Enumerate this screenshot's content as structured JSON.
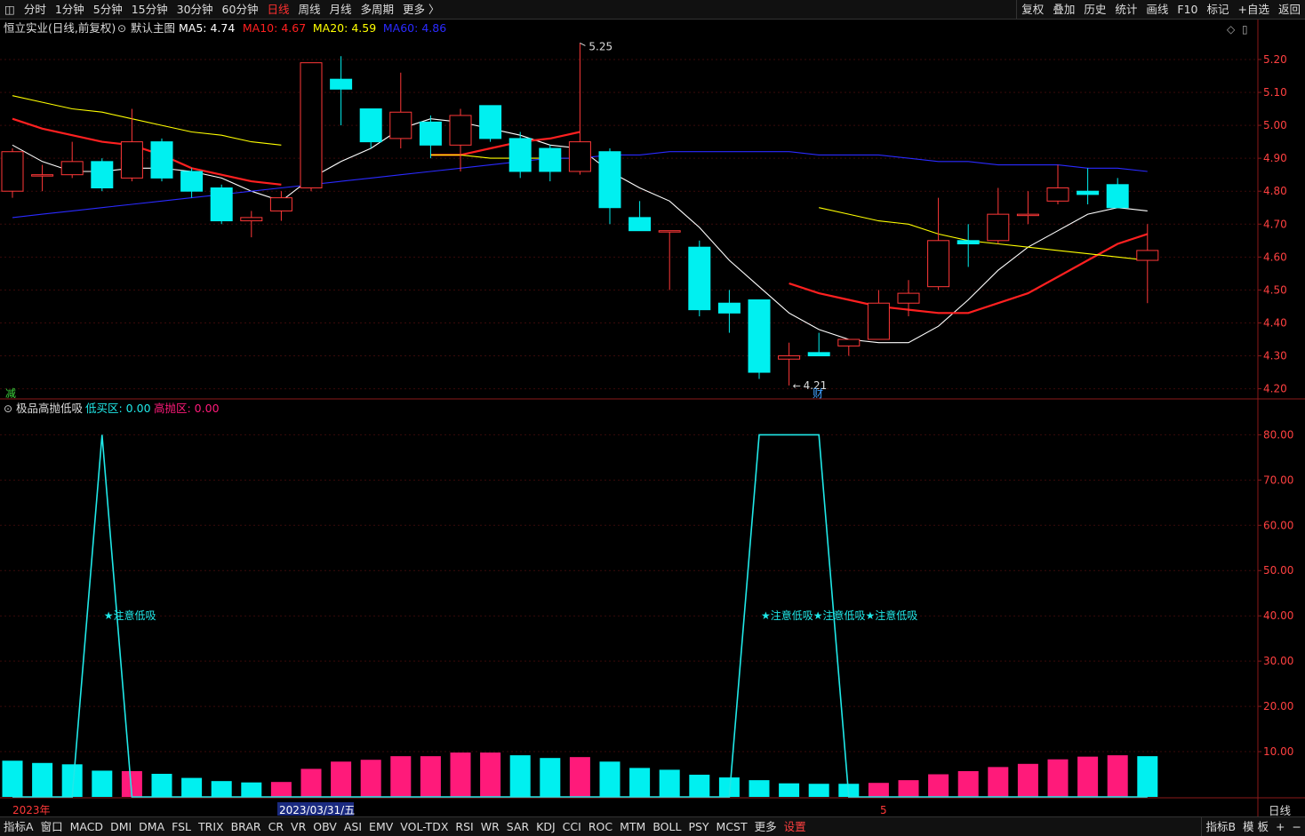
{
  "toolbar": {
    "periods": [
      "分时",
      "1分钟",
      "5分钟",
      "15分钟",
      "30分钟",
      "60分钟",
      "日线",
      "周线",
      "月线",
      "多周期",
      "更多 〉"
    ],
    "active_period": "日线",
    "right_items": [
      "复权",
      "叠加",
      "历史",
      "统计",
      "画线",
      "F10",
      "标记",
      "+自选",
      "返回"
    ]
  },
  "main_header": {
    "stock": "恒立实业(日线,前复权)",
    "template": "默认主图",
    "ma_labels": [
      {
        "text": "MA5: 4.74",
        "color": "#ffffff"
      },
      {
        "text": "MA10: 4.67",
        "color": "#ff2020"
      },
      {
        "text": "MA20: 4.59",
        "color": "#ffff00"
      },
      {
        "text": "MA60: 4.86",
        "color": "#2a2aff"
      }
    ]
  },
  "indicator_header": {
    "name": "极品高抛低吸",
    "low_label": "低买区: 0.00",
    "high_label": "高抛区: 0.00"
  },
  "chart_data": [
    {
      "type": "candlestick",
      "title": "恒立实业(日线,前复权)",
      "y_ticks": [
        "5.20",
        "5.10",
        "5.00",
        "4.90",
        "4.80",
        "4.70",
        "4.60",
        "4.50",
        "4.40",
        "4.30",
        "4.20"
      ],
      "ylim": [
        4.18,
        5.27
      ],
      "annotations": {
        "high": "5.25",
        "low": "4.21",
        "marker_jian": "减",
        "marker_cai": "财"
      },
      "candles": [
        {
          "o": 4.8,
          "h": 4.93,
          "l": 4.78,
          "c": 4.92
        },
        {
          "o": 4.85,
          "h": 4.88,
          "l": 4.8,
          "c": 4.85
        },
        {
          "o": 4.85,
          "h": 4.95,
          "l": 4.84,
          "c": 4.89
        },
        {
          "o": 4.89,
          "h": 4.9,
          "l": 4.8,
          "c": 4.81
        },
        {
          "o": 4.84,
          "h": 5.05,
          "l": 4.83,
          "c": 4.95
        },
        {
          "o": 4.95,
          "h": 4.96,
          "l": 4.83,
          "c": 4.84
        },
        {
          "o": 4.86,
          "h": 4.87,
          "l": 4.78,
          "c": 4.8
        },
        {
          "o": 4.81,
          "h": 4.82,
          "l": 4.7,
          "c": 4.71
        },
        {
          "o": 4.71,
          "h": 4.74,
          "l": 4.66,
          "c": 4.72
        },
        {
          "o": 4.74,
          "h": 4.8,
          "l": 4.71,
          "c": 4.78
        },
        {
          "o": 4.81,
          "h": 5.19,
          "l": 4.8,
          "c": 5.19
        },
        {
          "o": 5.14,
          "h": 5.21,
          "l": 5.0,
          "c": 5.11
        },
        {
          "o": 5.05,
          "h": 5.05,
          "l": 4.93,
          "c": 4.95
        },
        {
          "o": 4.96,
          "h": 5.16,
          "l": 4.93,
          "c": 5.04
        },
        {
          "o": 5.01,
          "h": 5.03,
          "l": 4.9,
          "c": 4.94
        },
        {
          "o": 4.94,
          "h": 5.05,
          "l": 4.86,
          "c": 5.03
        },
        {
          "o": 5.06,
          "h": 5.06,
          "l": 4.95,
          "c": 4.96
        },
        {
          "o": 4.96,
          "h": 4.98,
          "l": 4.84,
          "c": 4.86
        },
        {
          "o": 4.93,
          "h": 4.94,
          "l": 4.83,
          "c": 4.86
        },
        {
          "o": 4.86,
          "h": 5.25,
          "l": 4.85,
          "c": 4.95
        },
        {
          "o": 4.92,
          "h": 4.93,
          "l": 4.7,
          "c": 4.75
        },
        {
          "o": 4.72,
          "h": 4.77,
          "l": 4.68,
          "c": 4.68
        },
        {
          "o": 4.68,
          "h": 4.68,
          "l": 4.5,
          "c": 4.68
        },
        {
          "o": 4.63,
          "h": 4.65,
          "l": 4.42,
          "c": 4.44
        },
        {
          "o": 4.46,
          "h": 4.5,
          "l": 4.37,
          "c": 4.43
        },
        {
          "o": 4.47,
          "h": 4.47,
          "l": 4.23,
          "c": 4.25
        },
        {
          "o": 4.29,
          "h": 4.34,
          "l": 4.21,
          "c": 4.3
        },
        {
          "o": 4.31,
          "h": 4.37,
          "l": 4.3,
          "c": 4.3
        },
        {
          "o": 4.33,
          "h": 4.35,
          "l": 4.3,
          "c": 4.35
        },
        {
          "o": 4.35,
          "h": 4.5,
          "l": 4.35,
          "c": 4.46
        },
        {
          "o": 4.46,
          "h": 4.53,
          "l": 4.42,
          "c": 4.49
        },
        {
          "o": 4.51,
          "h": 4.78,
          "l": 4.5,
          "c": 4.65
        },
        {
          "o": 4.65,
          "h": 4.7,
          "l": 4.57,
          "c": 4.64
        },
        {
          "o": 4.65,
          "h": 4.81,
          "l": 4.64,
          "c": 4.73
        },
        {
          "o": 4.73,
          "h": 4.8,
          "l": 4.7,
          "c": 4.73
        },
        {
          "o": 4.77,
          "h": 4.88,
          "l": 4.76,
          "c": 4.81
        },
        {
          "o": 4.8,
          "h": 4.87,
          "l": 4.76,
          "c": 4.79
        },
        {
          "o": 4.82,
          "h": 4.84,
          "l": 4.75,
          "c": 4.75
        },
        {
          "o": 4.59,
          "h": 4.7,
          "l": 4.46,
          "c": 4.62
        }
      ],
      "series": [
        {
          "name": "MA5",
          "color": "#ffffff",
          "values": [
            4.94,
            4.89,
            4.86,
            4.86,
            4.87,
            4.87,
            4.86,
            4.84,
            4.8,
            4.77,
            4.84,
            4.89,
            4.93,
            4.99,
            5.02,
            5.01,
            4.99,
            4.97,
            4.94,
            4.93,
            4.86,
            4.81,
            4.77,
            4.69,
            4.59,
            4.51,
            4.43,
            4.38,
            4.35,
            4.34,
            4.34,
            4.39,
            4.47,
            4.56,
            4.63,
            4.68,
            4.73,
            4.75,
            4.74
          ]
        },
        {
          "name": "MA10",
          "color": "#ff2020",
          "values": [
            5.02,
            4.99,
            4.97,
            4.95,
            4.94,
            4.91,
            4.87,
            4.85,
            4.83,
            4.82,
            null,
            null,
            null,
            null,
            4.91,
            4.91,
            4.93,
            4.95,
            4.96,
            4.98,
            null,
            null,
            null,
            null,
            null,
            null,
            4.52,
            4.49,
            4.47,
            4.45,
            4.44,
            4.43,
            4.43,
            4.46,
            4.49,
            4.54,
            4.59,
            4.64,
            4.67
          ]
        },
        {
          "name": "MA20",
          "color": "#ffff00",
          "values": [
            5.09,
            5.07,
            5.05,
            5.04,
            5.02,
            5.0,
            4.98,
            4.97,
            4.95,
            4.94,
            null,
            null,
            null,
            null,
            4.91,
            4.91,
            4.9,
            4.9,
            4.9,
            4.9,
            null,
            null,
            null,
            null,
            null,
            null,
            null,
            4.75,
            4.73,
            4.71,
            4.7,
            4.67,
            4.65,
            4.64,
            4.63,
            4.62,
            4.61,
            4.6,
            4.59
          ]
        },
        {
          "name": "MA60",
          "color": "#2a2aff",
          "values": [
            4.72,
            4.73,
            4.74,
            4.75,
            4.76,
            4.77,
            4.78,
            4.79,
            4.8,
            4.81,
            4.82,
            4.83,
            4.84,
            4.85,
            4.86,
            4.87,
            4.88,
            4.89,
            4.9,
            4.9,
            4.91,
            4.91,
            4.92,
            4.92,
            4.92,
            4.92,
            4.92,
            4.91,
            4.91,
            4.91,
            4.9,
            4.89,
            4.89,
            4.88,
            4.88,
            4.88,
            4.87,
            4.87,
            4.86
          ]
        }
      ]
    },
    {
      "type": "bar",
      "title": "极品高抛低吸",
      "y_ticks": [
        "80.00",
        "70.00",
        "60.00",
        "50.00",
        "40.00",
        "30.00",
        "20.00",
        "10.00"
      ],
      "ylim": [
        0,
        84
      ],
      "values": [
        8,
        7.5,
        7.2,
        5.8,
        5.7,
        5.1,
        4.2,
        3.5,
        3.2,
        3.3,
        6.2,
        7.8,
        8.2,
        9.0,
        9.0,
        9.8,
        9.8,
        9.2,
        8.6,
        8.8,
        7.8,
        6.4,
        6.0,
        4.9,
        4.3,
        3.7,
        3.0,
        2.9,
        2.9,
        3.1,
        3.7,
        5.0,
        5.7,
        6.6,
        7.3,
        8.3,
        8.9,
        9.2,
        9.0
      ],
      "color_index": [
        "c",
        "c",
        "c",
        "c",
        "m",
        "c",
        "c",
        "c",
        "c",
        "m",
        "m",
        "m",
        "m",
        "m",
        "m",
        "m",
        "m",
        "c",
        "c",
        "m",
        "c",
        "c",
        "c",
        "c",
        "c",
        "c",
        "c",
        "c",
        "c",
        "m",
        "m",
        "m",
        "m",
        "m",
        "m",
        "m",
        "m",
        "m",
        "c"
      ],
      "signal_series": {
        "name": "signal",
        "values": [
          0,
          0,
          0,
          80,
          0,
          0,
          0,
          0,
          0,
          0,
          0,
          0,
          0,
          0,
          0,
          0,
          0,
          0,
          0,
          0,
          0,
          0,
          0,
          0,
          0,
          80,
          80,
          80,
          0,
          0,
          0,
          0,
          0,
          0,
          0,
          0,
          0,
          0,
          0
        ]
      },
      "signal_texts": [
        "★注意低吸",
        "★注意低吸★注意低吸★注意低吸"
      ]
    }
  ],
  "x_axis": {
    "left_label": "2023年",
    "date_label": "2023/03/31/五",
    "month_label": "5",
    "period_badge": "日线"
  },
  "bottom": {
    "items": [
      "指标A",
      "窗口",
      "MACD",
      "DMI",
      "DMA",
      "FSL",
      "TRIX",
      "BRAR",
      "CR",
      "VR",
      "OBV",
      "ASI",
      "EMV",
      "VOL-TDX",
      "RSI",
      "WR",
      "SAR",
      "KDJ",
      "CCI",
      "ROC",
      "MTM",
      "BOLL",
      "PSY",
      "MCST",
      "更多",
      "设置"
    ],
    "active": "设置",
    "right": [
      "指标B",
      "模 板",
      "+",
      "−"
    ]
  },
  "colors": {
    "up": "#ff3838",
    "down": "#00f0f0",
    "magenta": "#ff1a7a",
    "axis": "#8b1a1a",
    "grid": "#3a0a0a"
  }
}
